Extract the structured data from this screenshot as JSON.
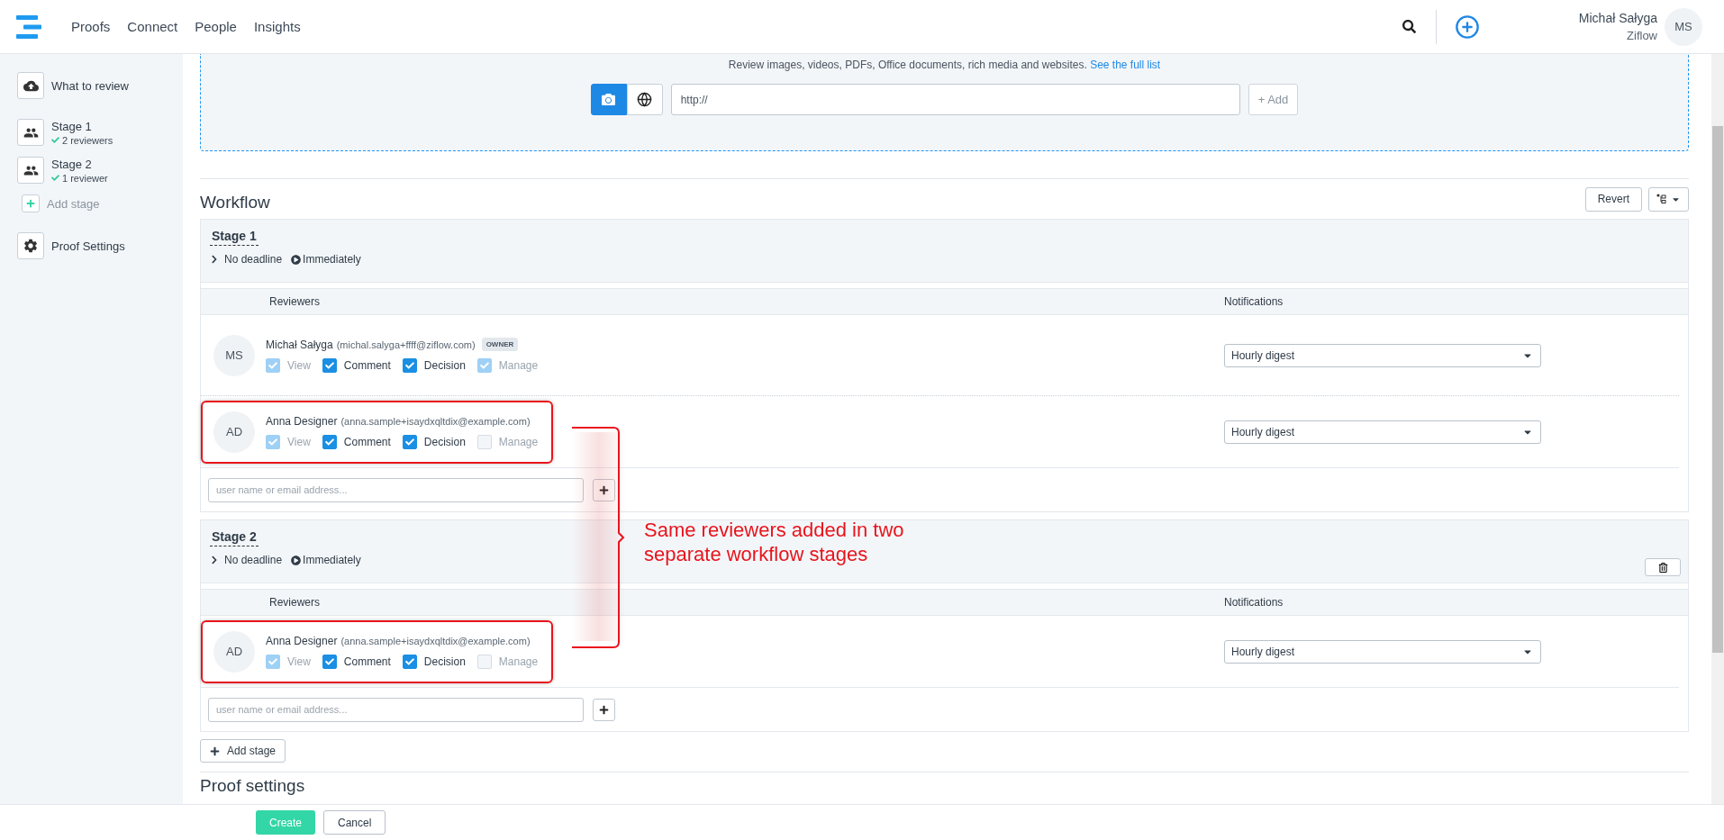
{
  "nav": {
    "items": [
      "Proofs",
      "Connect",
      "People",
      "Insights"
    ]
  },
  "user": {
    "name": "Michał Sałyga",
    "org": "Ziflow",
    "initials": "MS"
  },
  "sidebar": {
    "items": [
      {
        "kind": "upload",
        "label": "What to review"
      },
      {
        "kind": "stage",
        "label": "Stage 1",
        "status": "2 reviewers"
      },
      {
        "kind": "stage",
        "label": "Stage 2",
        "status": "1 reviewer"
      },
      {
        "kind": "add",
        "label": "Add stage"
      },
      {
        "kind": "settings",
        "label": "Proof Settings"
      }
    ]
  },
  "upload": {
    "hint": "Review images, videos, PDFs, Office documents, rich media and websites.",
    "link": "See the full list",
    "modes": [
      {
        "kind": "file",
        "selected": true
      },
      {
        "kind": "web",
        "selected": false
      }
    ],
    "url": "http://",
    "add": "+ Add"
  },
  "workflow": {
    "title": "Workflow",
    "revert": "Revert"
  },
  "stages": [
    {
      "title": "Stage 1",
      "deadline": "No deadline",
      "start": "Immediately",
      "deletable": false,
      "columns": [
        "Reviewers",
        "Notifications"
      ],
      "placeholder": "user name or email address...",
      "reviewers": [
        {
          "initials": "MS",
          "name": "Michał Sałyga",
          "email": "(michal.salyga+ffff@ziflow.com)",
          "badge": "OWNER",
          "highlighted": false,
          "notification": "Hourly digest",
          "permissions": [
            {
              "label": "View",
              "checked": true,
              "disabled": true
            },
            {
              "label": "Comment",
              "checked": true,
              "disabled": false
            },
            {
              "label": "Decision",
              "checked": true,
              "disabled": false
            },
            {
              "label": "Manage",
              "checked": true,
              "disabled": true
            }
          ]
        },
        {
          "initials": "AD",
          "name": "Anna Designer",
          "email": "(anna.sample+isaydxqltdix@example.com)",
          "highlighted": true,
          "notification": "Hourly digest",
          "permissions": [
            {
              "label": "View",
              "checked": true,
              "disabled": true
            },
            {
              "label": "Comment",
              "checked": true,
              "disabled": false
            },
            {
              "label": "Decision",
              "checked": true,
              "disabled": false
            },
            {
              "label": "Manage",
              "checked": false,
              "disabled": true
            }
          ]
        }
      ]
    },
    {
      "title": "Stage 2",
      "deadline": "No deadline",
      "start": "Immediately",
      "deletable": true,
      "columns": [
        "Reviewers",
        "Notifications"
      ],
      "placeholder": "user name or email address...",
      "reviewers": [
        {
          "initials": "AD",
          "name": "Anna Designer",
          "email": "(anna.sample+isaydxqltdix@example.com)",
          "highlighted": true,
          "notification": "Hourly digest",
          "permissions": [
            {
              "label": "View",
              "checked": true,
              "disabled": true
            },
            {
              "label": "Comment",
              "checked": true,
              "disabled": false
            },
            {
              "label": "Decision",
              "checked": true,
              "disabled": false
            },
            {
              "label": "Manage",
              "checked": false,
              "disabled": true
            }
          ]
        }
      ]
    }
  ],
  "add_stage": "Add stage",
  "proof_settings": "Proof settings",
  "annotation": {
    "text": "Same reviewers added in two separate workflow stages"
  },
  "footer": {
    "create": "Create",
    "cancel": "Cancel"
  }
}
